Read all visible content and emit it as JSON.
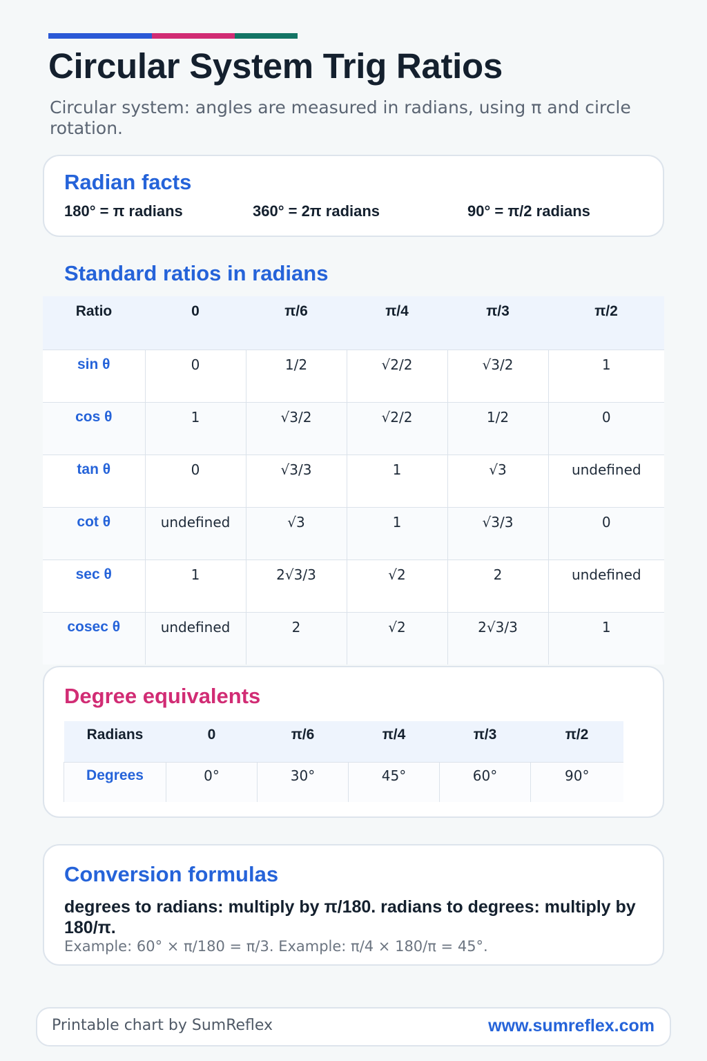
{
  "colors": {
    "bar_blue": "#2b59d6",
    "bar_pink": "#d12c74",
    "bar_teal": "#137565",
    "heading_blue": "#2563d9",
    "heading_pink": "#d12c74"
  },
  "header": {
    "title": "Circular System Trig Ratios",
    "subtitle": "Circular system: angles are measured in radians, using π and circle rotation."
  },
  "facts": {
    "heading": "Radian facts",
    "items": [
      "180° = π radians",
      "360° = 2π radians",
      "90° = π/2 radians"
    ]
  },
  "ratios": {
    "heading": "Standard ratios in radians",
    "columns": [
      "Ratio",
      "0",
      "π/6",
      "π/4",
      "π/3",
      "π/2"
    ],
    "rows": [
      {
        "label": "sin θ",
        "values": [
          "0",
          "1/2",
          "√2/2",
          "√3/2",
          "1"
        ]
      },
      {
        "label": "cos θ",
        "values": [
          "1",
          "√3/2",
          "√2/2",
          "1/2",
          "0"
        ]
      },
      {
        "label": "tan θ",
        "values": [
          "0",
          "√3/3",
          "1",
          "√3",
          "undefined"
        ]
      },
      {
        "label": "cot θ",
        "values": [
          "undefined",
          "√3",
          "1",
          "√3/3",
          "0"
        ]
      },
      {
        "label": "sec θ",
        "values": [
          "1",
          "2√3/3",
          "√2",
          "2",
          "undefined"
        ]
      },
      {
        "label": "cosec θ",
        "values": [
          "undefined",
          "2",
          "√2",
          "2√3/3",
          "1"
        ]
      }
    ]
  },
  "degrees": {
    "heading": "Degree equivalents",
    "columns": [
      "Radians",
      "0",
      "π/6",
      "π/4",
      "π/3",
      "π/2"
    ],
    "row": {
      "label": "Degrees",
      "values": [
        "0°",
        "30°",
        "45°",
        "60°",
        "90°"
      ]
    }
  },
  "conversion": {
    "heading": "Conversion formulas",
    "text": "degrees to radians: multiply by π/180. radians to degrees: multiply by 180/π.",
    "example": "Example: 60° × π/180 = π/3. Example: π/4 × 180/π = 45°."
  },
  "footer": {
    "credit": "Printable chart by SumReflex",
    "url": "www.sumreflex.com"
  }
}
